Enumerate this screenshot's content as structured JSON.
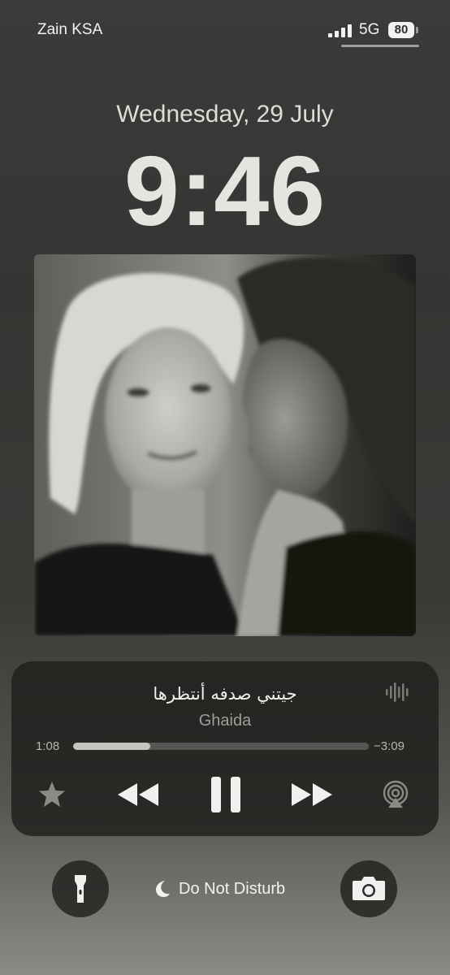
{
  "status_bar": {
    "carrier": "Zain KSA",
    "network": "5G",
    "battery_level": "80",
    "signal_bars_filled": 4
  },
  "lock_screen": {
    "date": "Wednesday, 29 July",
    "time": "9:46"
  },
  "now_playing": {
    "title": "جيتني صدفه أنتظرها",
    "artist": "Ghaida",
    "elapsed": "1:08",
    "remaining": "−3:09",
    "progress_fraction": 0.26,
    "controls": {
      "favorite": "star-icon",
      "previous": "rewind-icon",
      "play_pause": "pause-icon",
      "next": "fast-forward-icon",
      "output": "airplay-icon",
      "visualizer": "waveform-icon"
    },
    "artwork": "black-and-white photo of two women"
  },
  "quick_actions": {
    "left": "flashlight-icon",
    "focus_label": "Do Not Disturb",
    "focus_icon": "moon-icon",
    "right": "camera-icon"
  },
  "colors": {
    "background": "#383836",
    "player_bg": "#1e1e1c",
    "progress_fill": "#c4c4c0",
    "text_primary": "#f0f0ee",
    "text_secondary": "#9d9d99"
  }
}
